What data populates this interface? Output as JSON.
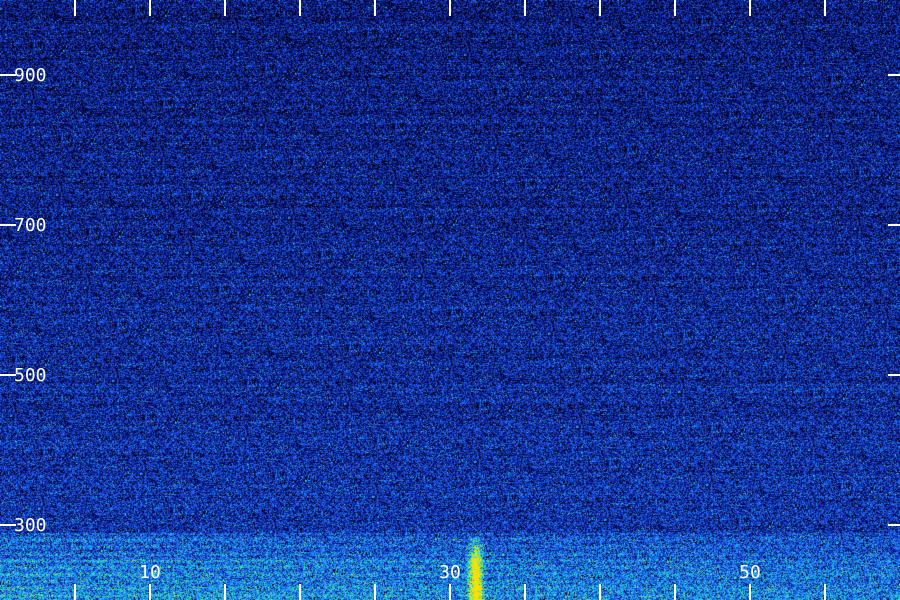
{
  "chart_data": {
    "type": "heatmap",
    "title": "",
    "xlabel": "",
    "ylabel": "",
    "xlim": [
      0,
      60
    ],
    "ylim": [
      200,
      1000
    ],
    "x_ticks": [
      {
        "value": 10,
        "label": "10"
      },
      {
        "value": 30,
        "label": "30"
      },
      {
        "value": 50,
        "label": "50"
      }
    ],
    "y_ticks": [
      {
        "value": 300,
        "label": "300"
      },
      {
        "value": 500,
        "label": "500"
      },
      {
        "value": 700,
        "label": "700"
      },
      {
        "value": 900,
        "label": "900"
      }
    ],
    "minor_x_ticks": [
      5,
      15,
      20,
      25,
      35,
      40,
      45,
      55
    ],
    "colormap": [
      "#000014",
      "#0a1a8c",
      "#1c43d6",
      "#1e90ff",
      "#27e0c8",
      "#9cf03a",
      "#ffe000"
    ],
    "features": [
      {
        "kind": "vertical-burst",
        "x": 31.7,
        "y_range": [
          200,
          290
        ],
        "peak_color": "#ffe000"
      },
      {
        "kind": "low-band",
        "y_range": [
          200,
          290
        ],
        "intensity": 0.55
      }
    ],
    "grid": false
  }
}
